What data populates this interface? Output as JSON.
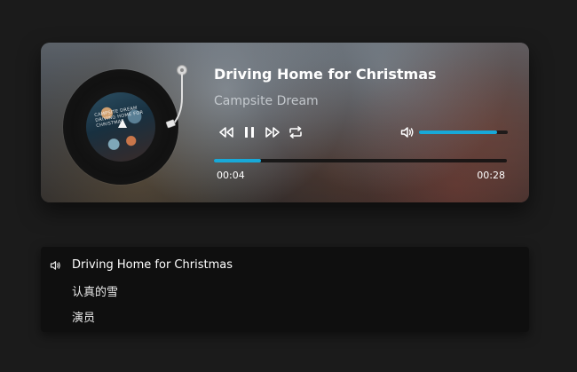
{
  "player": {
    "title": "Driving Home for Christmas",
    "artist": "Campsite Dream",
    "album_cover_text": "CAMPSITE DREAM DRIVING HOME FOR CHRISTMAS",
    "current_time": "00:04",
    "total_time": "00:28",
    "progress_fraction": 0.16,
    "volume_fraction": 0.88,
    "state": "playing",
    "controls": [
      "rewind-icon",
      "pause-icon",
      "fast-forward-icon",
      "repeat-icon"
    ],
    "volume_icon": "volume-icon",
    "accent_color": "#18a9d8"
  },
  "playlist": {
    "items": [
      {
        "name": "Driving Home for Christmas",
        "active": true
      },
      {
        "name": "认真的雪",
        "active": false
      },
      {
        "name": "演员",
        "active": false
      }
    ],
    "active_icon": "volume-icon"
  }
}
